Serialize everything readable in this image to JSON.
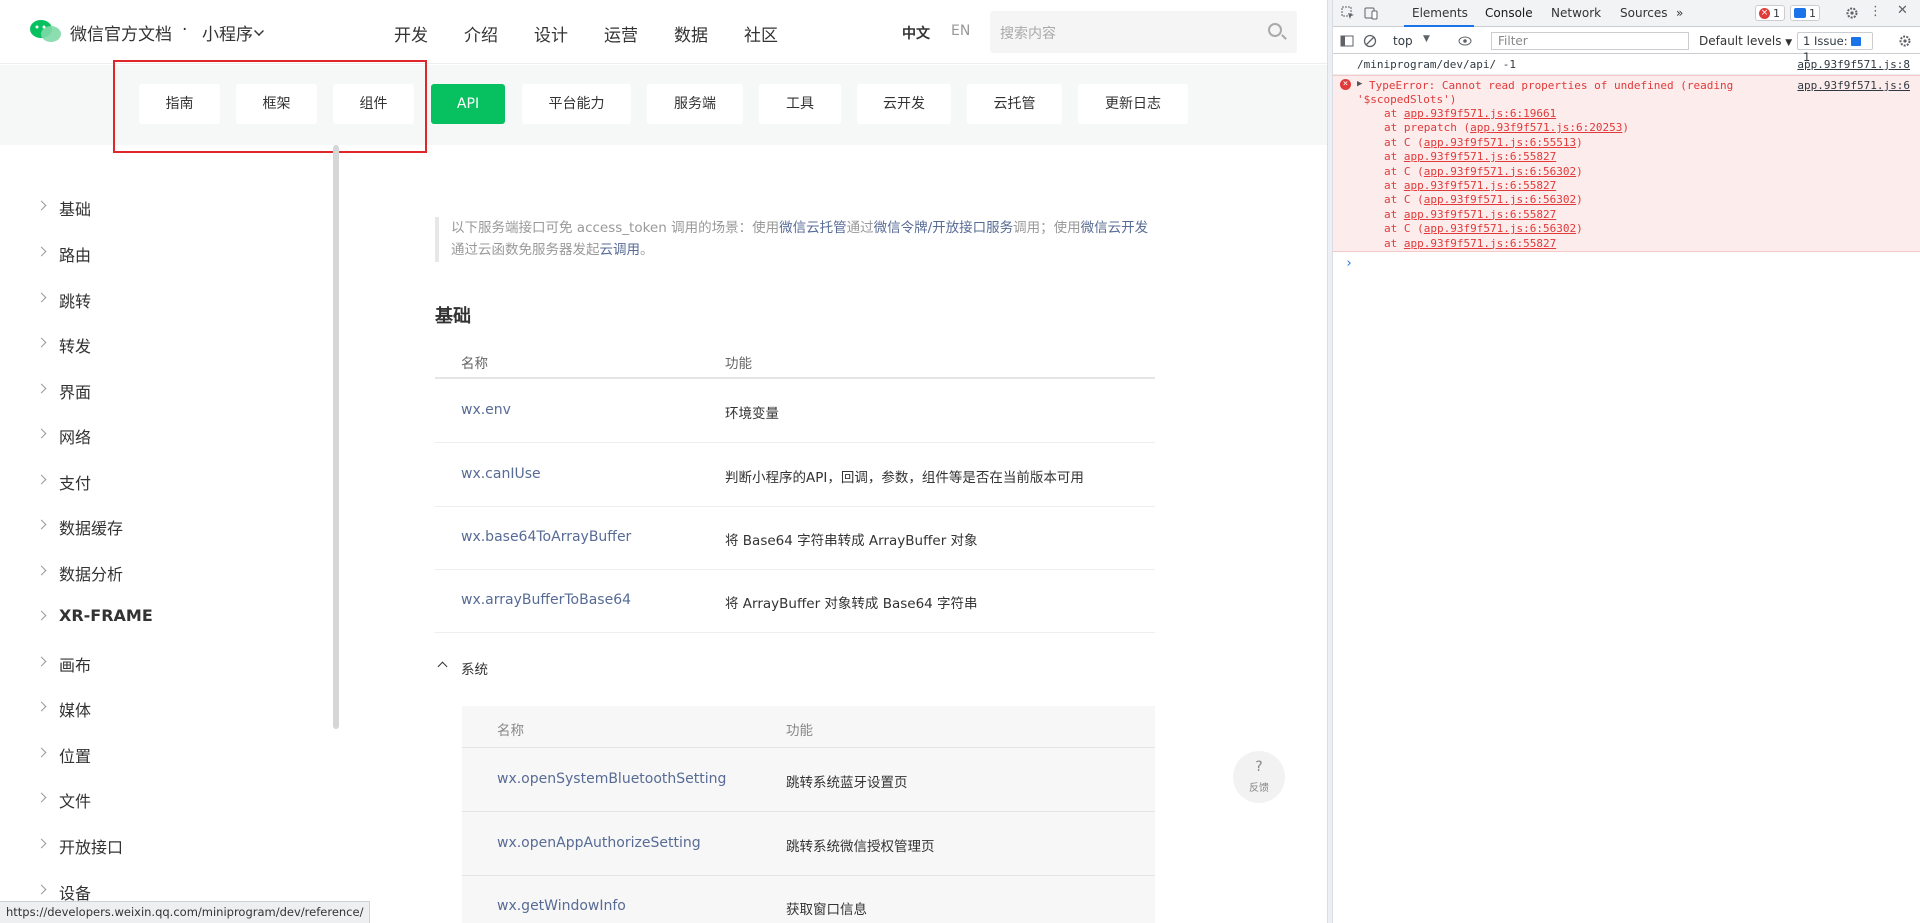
{
  "header": {
    "brand": "微信官方文档",
    "dot": "·",
    "product": "小程序",
    "nav": [
      "开发",
      "介绍",
      "设计",
      "运营",
      "数据",
      "社区"
    ],
    "lang_cn": "中文",
    "lang_en": "EN",
    "search_placeholder": "搜索内容"
  },
  "subnav": {
    "items": [
      "指南",
      "框架",
      "组件",
      "API",
      "平台能力",
      "服务端",
      "工具",
      "云开发",
      "云托管",
      "更新日志"
    ],
    "active": "API"
  },
  "sidebar": {
    "items": [
      "基础",
      "路由",
      "跳转",
      "转发",
      "界面",
      "网络",
      "支付",
      "数据缓存",
      "数据分析",
      "XR-FRAME",
      "画布",
      "媒体",
      "位置",
      "文件",
      "开放接口",
      "设备"
    ]
  },
  "main": {
    "note_parts": [
      "以下服务端接口可免 access_token 调用的场景：使用",
      "微信云托管",
      "通过",
      "微信令牌/开放接口服务",
      "调用；使用",
      "微信云开发",
      "通过云函数免服务器发起",
      "云调用",
      "。"
    ],
    "section_title": "基础",
    "col_name": "名称",
    "col_func": "功能",
    "rows": [
      {
        "name": "wx.env",
        "desc": "环境变量"
      },
      {
        "name": "wx.canIUse",
        "desc": "判断小程序的API，回调，参数，组件等是否在当前版本可用"
      },
      {
        "name": "wx.base64ToArrayBuffer",
        "desc": "将 Base64 字符串转成 ArrayBuffer 对象"
      },
      {
        "name": "wx.arrayBufferToBase64",
        "desc": "将 ArrayBuffer 对象转成 Base64 字符串"
      }
    ],
    "subsection": "系统",
    "sub_rows": [
      {
        "name": "wx.openSystemBluetoothSetting",
        "desc": "跳转系统蓝牙设置页"
      },
      {
        "name": "wx.openAppAuthorizeSetting",
        "desc": "跳转系统微信授权管理页"
      },
      {
        "name": "wx.getWindowInfo",
        "desc": "获取窗口信息"
      }
    ]
  },
  "feedback": {
    "icon": "?",
    "label": "反馈"
  },
  "status_url": "https://developers.weixin.qq.com/miniprogram/dev/reference/",
  "devtools": {
    "tabs": [
      "Elements",
      "Console",
      "Network",
      "Sources"
    ],
    "active_tab": "Console",
    "more": "»",
    "error_count": "1",
    "msg_count": "1",
    "context": "top",
    "filter_placeholder": "Filter",
    "levels": "Default levels",
    "issues": "1 Issue:",
    "issues_count": "1",
    "log_path": "/miniprogram/dev/api/ -1",
    "log_src": "app.93f9f571.js:8",
    "error_line1": "TypeError: Cannot read properties of undefined (reading",
    "error_line2": "'$scopedSlots')",
    "error_src": "app.93f9f571.js:6",
    "stack": [
      {
        "pre": "at ",
        "fn": "",
        "loc": "app.93f9f571.js:6:19661"
      },
      {
        "pre": "at prepatch (",
        "fn": "prepatch",
        "loc": "app.93f9f571.js:6:20253"
      },
      {
        "pre": "at C (",
        "fn": "C",
        "loc": "app.93f9f571.js:6:55513"
      },
      {
        "pre": "at ",
        "fn": "",
        "loc": "app.93f9f571.js:6:55827"
      },
      {
        "pre": "at C (",
        "fn": "C",
        "loc": "app.93f9f571.js:6:56302"
      },
      {
        "pre": "at ",
        "fn": "",
        "loc": "app.93f9f571.js:6:55827"
      },
      {
        "pre": "at C (",
        "fn": "C",
        "loc": "app.93f9f571.js:6:56302"
      },
      {
        "pre": "at ",
        "fn": "",
        "loc": "app.93f9f571.js:6:55827"
      },
      {
        "pre": "at C (",
        "fn": "C",
        "loc": "app.93f9f571.js:6:56302"
      },
      {
        "pre": "at ",
        "fn": "",
        "loc": "app.93f9f571.js:6:55827"
      }
    ],
    "prompt": "›"
  },
  "colors": {
    "accent": "#07c160",
    "link": "#576b95",
    "error": "#e03a3a",
    "highlight_box": "#e0262b"
  }
}
